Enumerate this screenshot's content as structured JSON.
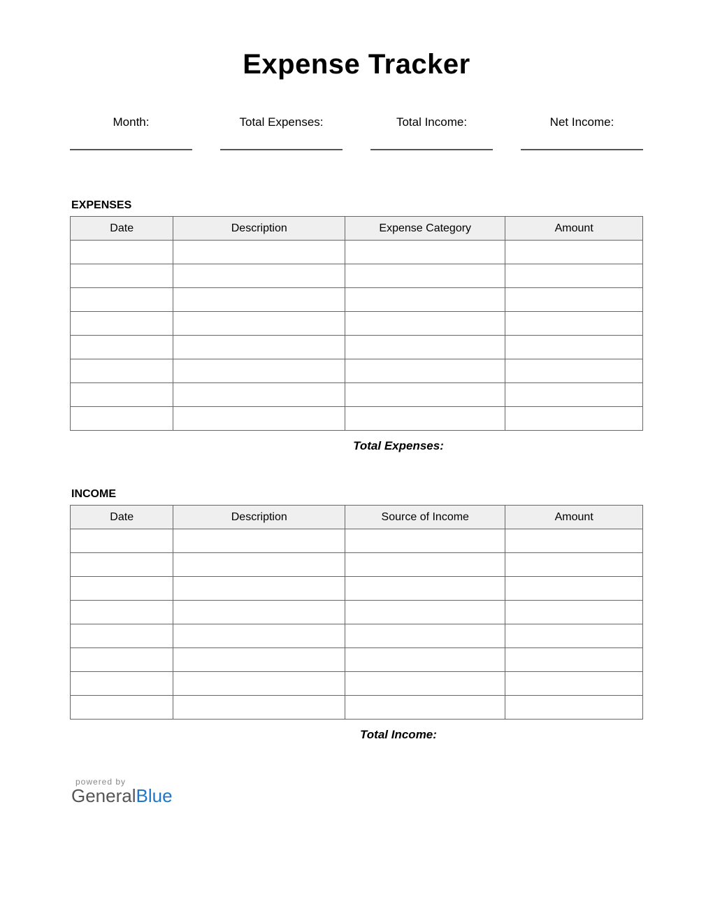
{
  "title": "Expense Tracker",
  "summary": {
    "month_label": "Month:",
    "total_expenses_label": "Total Expenses:",
    "total_income_label": "Total Income:",
    "net_income_label": "Net Income:"
  },
  "expenses": {
    "heading": "EXPENSES",
    "columns": {
      "date": "Date",
      "description": "Description",
      "category": "Expense Category",
      "amount": "Amount"
    },
    "rows": [
      "",
      "",
      "",
      "",
      "",
      "",
      "",
      ""
    ],
    "total_label": "Total Expenses:"
  },
  "income": {
    "heading": "INCOME",
    "columns": {
      "date": "Date",
      "description": "Description",
      "source": "Source of Income",
      "amount": "Amount"
    },
    "rows": [
      "",
      "",
      "",
      "",
      "",
      "",
      "",
      ""
    ],
    "total_label": "Total Income:"
  },
  "footer": {
    "powered_by": "powered by",
    "brand_part1": "General",
    "brand_part2": "Blue"
  }
}
